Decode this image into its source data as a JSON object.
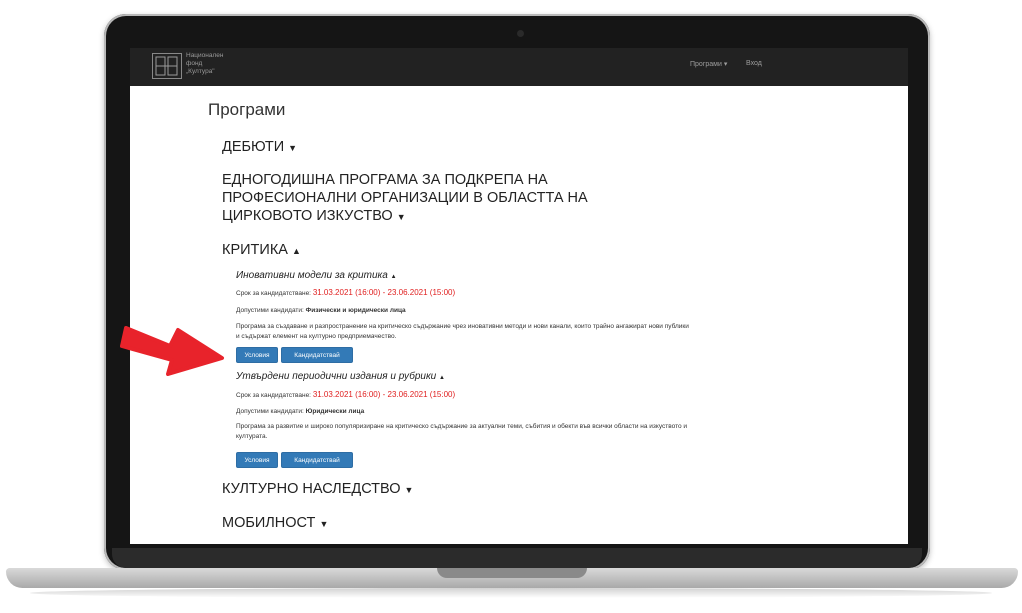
{
  "navbar": {
    "logo_line1": "Национален",
    "logo_line2": "фонд",
    "logo_line3": "„Култура\"",
    "programs_menu": "Програми",
    "programs_caret": "▾",
    "login": "Вход"
  },
  "page": {
    "title": "Програми"
  },
  "sections": {
    "debuti": {
      "title": "ДЕБЮТИ",
      "arrow": "▼"
    },
    "circus": {
      "title": "ЕДНОГОДИШНА ПРОГРАМА ЗА ПОДКРЕПА НА ПРОФЕСИОНАЛНИ ОРГАНИЗАЦИИ В ОБЛАСТТА НА ЦИРКОВОТО ИЗКУСТВО",
      "arrow": "▼"
    },
    "kritika": {
      "title": "КРИТИКА",
      "arrow": "▲"
    },
    "heritage": {
      "title": "КУЛТУРНО НАСЛЕДСТВО",
      "arrow": "▼"
    },
    "mobility": {
      "title": "МОБИЛНОСТ",
      "arrow": "▼"
    }
  },
  "programs": [
    {
      "title": "Иновативни модели за критика",
      "arrow": "▲",
      "deadline_label": "Срок за кандидатстване:",
      "deadline_value": "31.03.2021 (16:00) - 23.06.2021 (15:00)",
      "candidates_label": "Допустими кандидати:",
      "candidates_value": "Физически и юридически лица",
      "description": "Програма за създаване и разпространение на критическо съдържание чрез иновативни методи и нови канали, които трайно ангажират нови публики и съдържат елемент на културно предприемачество.",
      "btn_conditions": "Условия",
      "btn_apply": "Кандидатствай"
    },
    {
      "title": "Утвърдени периодични издания и рубрики",
      "arrow": "▲",
      "deadline_label": "Срок за кандидатстване:",
      "deadline_value": "31.03.2021 (16:00) - 23.06.2021 (15:00)",
      "candidates_label": "Допустими кандидати:",
      "candidates_value": "Юридически лица",
      "description": "Програма за развитие и широко популяризиране на критическо съдържание за актуални теми, събития и обекти във всички области на изкуството и културата.",
      "btn_conditions": "Условия",
      "btn_apply": "Кандидатствай"
    }
  ],
  "colors": {
    "accent": "#337ab7",
    "deadline": "#e02020",
    "annotation": "#e8232b",
    "navbar": "#222222"
  },
  "icons": {
    "annotation": "red-pointer-arrow-icon",
    "logo": "fund-logo-icon"
  }
}
